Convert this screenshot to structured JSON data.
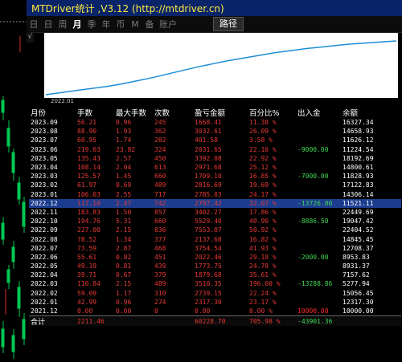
{
  "window": {
    "title": "MTDriver统计 ,V3.12 (http://mtdriver.cn)"
  },
  "tabs": [
    {
      "label": "日",
      "active": false
    },
    {
      "label": "日",
      "active": false
    },
    {
      "label": "周",
      "active": false
    },
    {
      "label": "月",
      "active": true
    },
    {
      "label": "季",
      "active": false
    },
    {
      "label": "年",
      "active": false
    },
    {
      "label": "币",
      "active": false
    },
    {
      "label": "M",
      "active": false
    },
    {
      "label": "备",
      "active": false
    },
    {
      "label": "账户",
      "active": false
    }
  ],
  "path_button": "路径",
  "corner_label": "√",
  "equity_chart": {
    "x_label": "2022.01",
    "values": [
      10000,
      10400,
      10800,
      11200,
      11600,
      12100,
      12700,
      13300,
      14000,
      14700,
      15400,
      16000,
      16600,
      17100,
      17600,
      18100,
      18500,
      18900,
      19200,
      19500,
      19800,
      20000,
      20200,
      20400
    ]
  },
  "table": {
    "headers": [
      "月份",
      "手数",
      "最大手数",
      "次数",
      "盈亏金额",
      "百分比%",
      "出入金",
      "余额"
    ],
    "rows": [
      [
        "2023.09",
        "56.21",
        "0.96",
        "245",
        "1668.41",
        "11.38 %",
        "",
        "16327.34"
      ],
      [
        "2023.08",
        "88.90",
        "1.93",
        "362",
        "3032.61",
        "26.09 %",
        "",
        "14658.93"
      ],
      [
        "2023.07",
        "60.95",
        "1.74",
        "282",
        "401.58",
        "3.58 %",
        "",
        "11626.12"
      ],
      [
        "2023.06",
        "219.03",
        "23.82",
        "324",
        "2031.65",
        "22.10 %",
        "-9000.00",
        "11224.54"
      ],
      [
        "2023.05",
        "135.43",
        "2.57",
        "450",
        "3392.08",
        "22.92 %",
        "",
        "18192.69"
      ],
      [
        "2023.04",
        "108.14",
        "2.04",
        "613",
        "2971.68",
        "25.12 %",
        "",
        "14800.61"
      ],
      [
        "2023.03",
        "125.57",
        "1.45",
        "660",
        "1709.10",
        "16.85 %",
        "-7000.00",
        "11828.93"
      ],
      [
        "2023.02",
        "61.97",
        "0.69",
        "489",
        "2816.69",
        "19.69 %",
        "",
        "17122.83"
      ],
      [
        "2023.01",
        "106.03",
        "2.55",
        "717",
        "2785.03",
        "24.17 %",
        "",
        "14306.14"
      ],
      [
        "2022.12",
        "117.10",
        "2.47",
        "742",
        "2797.42",
        "32.07 %",
        "-13726.00",
        "11521.11"
      ],
      [
        "2022.11",
        "183.83",
        "1.50",
        "857",
        "3402.27",
        "17.86 %",
        "",
        "22449.69"
      ],
      [
        "2022.10",
        "194.76",
        "5.31",
        "660",
        "5529.40",
        "40.90 %",
        "-8886.50",
        "19047.42"
      ],
      [
        "2022.09",
        "227.00",
        "2.15",
        "836",
        "7553.07",
        "50.92 %",
        "",
        "22404.52"
      ],
      [
        "2022.08",
        "78.52",
        "1.34",
        "377",
        "2137.68",
        "16.82 %",
        "",
        "14845.45"
      ],
      [
        "2022.07",
        "73.59",
        "2.87",
        "468",
        "3754.54",
        "41.93 %",
        "",
        "12708.37"
      ],
      [
        "2022.06",
        "55.61",
        "0.82",
        "451",
        "2022.46",
        "29.18 %",
        "-2000.00",
        "8953.83"
      ],
      [
        "2022.05",
        "49.19",
        "0.81",
        "439",
        "1773.75",
        "24.78 %",
        "",
        "8931.37"
      ],
      [
        "2022.04",
        "39.71",
        "0.67",
        "379",
        "1879.68",
        "35.61 %",
        "",
        "7157.62"
      ],
      [
        "2022.03",
        "110.84",
        "2.15",
        "489",
        "3510.35",
        "196.00 %",
        "-13288.86",
        "5277.94"
      ],
      [
        "2022.02",
        "59.09",
        "1.17",
        "310",
        "2739.15",
        "22.24 %",
        "",
        "15056.45"
      ],
      [
        "2022.01",
        "42.99",
        "0.96",
        "274",
        "2317.30",
        "23.17 %",
        "",
        "12317.30"
      ],
      [
        "2021.12",
        "0.00",
        "0.00",
        "0",
        "0.00",
        "0.00 %",
        "10000.00",
        "10000.00"
      ]
    ],
    "selected_row": 9,
    "total": [
      "合计",
      "2211.46",
      "",
      "",
      "60228.70",
      "705.98 %",
      "-43901.36",
      ""
    ]
  },
  "colors": {
    "profit_red": "#e53935",
    "outflow_green": "#43d854",
    "inflow_red": "#ff2a2a",
    "title_yellow": "#ffeb3b",
    "equity_line": "#1f8dd6"
  }
}
